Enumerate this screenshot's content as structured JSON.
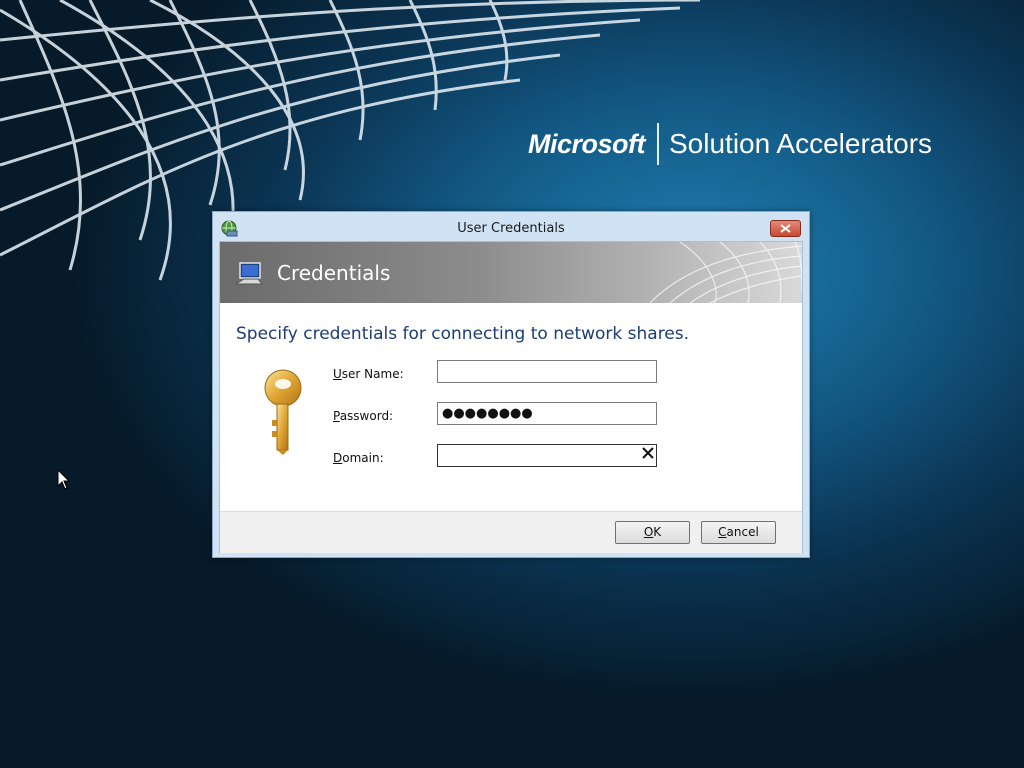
{
  "brand": {
    "company": "Microsoft",
    "product": "Solution Accelerators"
  },
  "window": {
    "title": "User Credentials",
    "close_icon": "close-icon"
  },
  "banner": {
    "title": "Credentials",
    "icon": "computer-icon"
  },
  "form": {
    "instruction": "Specify credentials for connecting to network shares.",
    "username": {
      "label_access": "U",
      "label_rest": "ser Name:",
      "value": ""
    },
    "password": {
      "label_access": "P",
      "label_rest": "assword:",
      "value": "●●●●●●●●"
    },
    "domain": {
      "label_access": "D",
      "label_rest": "omain:",
      "value": ""
    }
  },
  "buttons": {
    "ok": {
      "access": "O",
      "rest": "K"
    },
    "cancel": {
      "access": "C",
      "rest": "ancel"
    }
  },
  "colors": {
    "accent_text": "#1b3c78",
    "close_red": "#c74a34",
    "desktop_blue": "#135a86"
  }
}
